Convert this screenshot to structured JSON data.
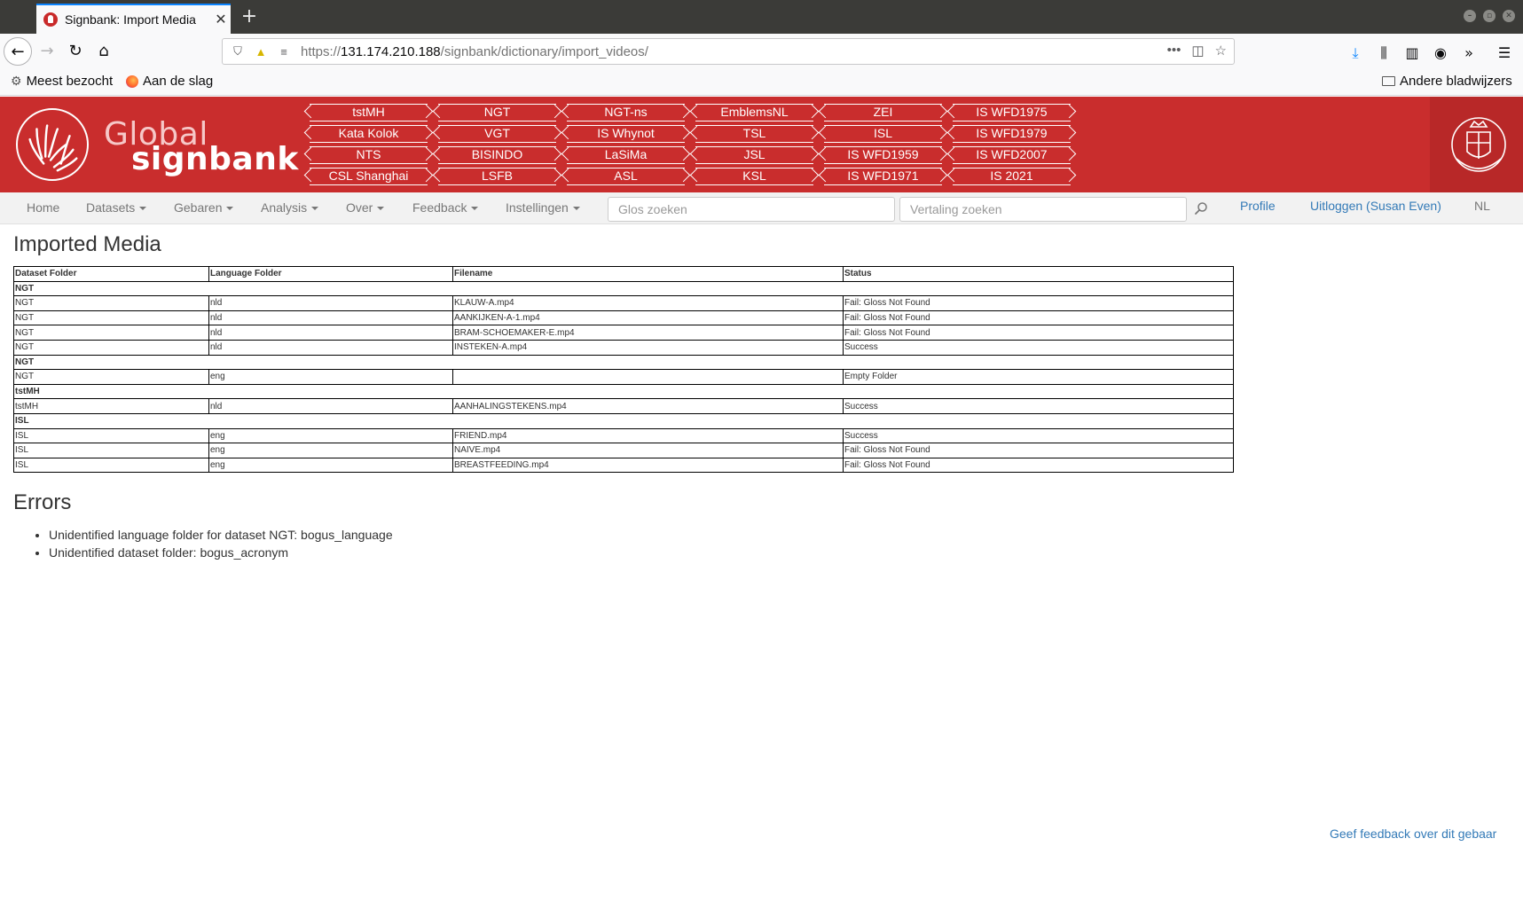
{
  "browser": {
    "tab_title": "Signbank: Import Media",
    "url_scheme": "https://",
    "url_host": "131.174.210.188",
    "url_path": "/signbank/dictionary/import_videos/",
    "bookmarks": [
      "Meest bezocht",
      "Aan de slag"
    ],
    "other_bookmarks": "Andere bladwijzers"
  },
  "header": {
    "logo_word1": "Global",
    "logo_word2": "signbank",
    "datasets": [
      "tstMH",
      "NGT",
      "NGT-ns",
      "EmblemsNL",
      "ZEI",
      "IS WFD1975",
      "Kata Kolok",
      "VGT",
      "IS Whynot",
      "TSL",
      "ISL",
      "IS WFD1979",
      "NTS",
      "BISINDO",
      "LaSiMa",
      "JSL",
      "IS WFD1959",
      "IS WFD2007",
      "CSL Shanghai",
      "LSFB",
      "ASL",
      "KSL",
      "IS WFD1971",
      "IS 2021"
    ]
  },
  "nav": {
    "home": "Home",
    "datasets": "Datasets",
    "gebaren": "Gebaren",
    "analysis": "Analysis",
    "over": "Over",
    "feedback": "Feedback",
    "instellingen": "Instellingen",
    "gloss_search_placeholder": "Glos zoeken",
    "translation_search_placeholder": "Vertaling zoeken",
    "profile": "Profile",
    "logout": "Uitloggen (Susan Even)",
    "language": "NL"
  },
  "main": {
    "title": "Imported Media",
    "columns": [
      "Dataset Folder",
      "Language Folder",
      "Filename",
      "Status"
    ],
    "groups": [
      {
        "label": "NGT",
        "rows": [
          [
            "NGT",
            "nld",
            "KLAUW-A.mp4",
            "Fail: Gloss Not Found"
          ],
          [
            "NGT",
            "nld",
            "AANKIJKEN-A-1.mp4",
            "Fail: Gloss Not Found"
          ],
          [
            "NGT",
            "nld",
            "BRAM-SCHOEMAKER-E.mp4",
            "Fail: Gloss Not Found"
          ],
          [
            "NGT",
            "nld",
            "INSTEKEN-A.mp4",
            "Success"
          ]
        ]
      },
      {
        "label": "NGT",
        "rows": [
          [
            "NGT",
            "eng",
            "",
            "Empty Folder"
          ]
        ]
      },
      {
        "label": "tstMH",
        "rows": [
          [
            "tstMH",
            "nld",
            "AANHALINGSTEKENS.mp4",
            "Success"
          ]
        ]
      },
      {
        "label": "ISL",
        "rows": [
          [
            "ISL",
            "eng",
            "FRIEND.mp4",
            "Success"
          ],
          [
            "ISL",
            "eng",
            "NAIVE.mp4",
            "Fail: Gloss Not Found"
          ],
          [
            "ISL",
            "eng",
            "BREASTFEEDING.mp4",
            "Fail: Gloss Not Found"
          ]
        ]
      }
    ],
    "errors_title": "Errors",
    "errors": [
      "Unidentified language folder for dataset NGT: bogus_language",
      "Unidentified dataset folder: bogus_acronym"
    ]
  },
  "footer": {
    "feedback_link": "Geef feedback over dit gebaar"
  }
}
